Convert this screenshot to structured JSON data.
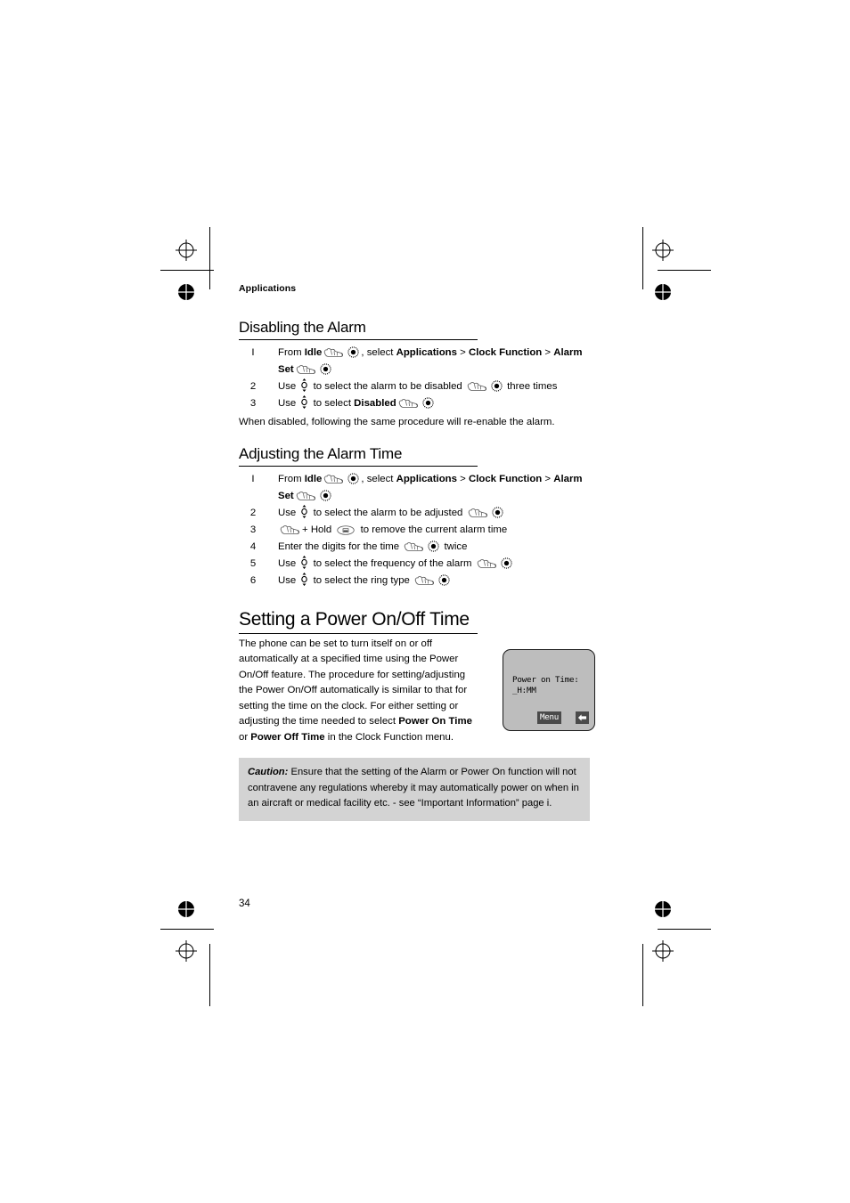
{
  "running_head": "Applications",
  "folio": "34",
  "colors": {
    "caution_bg": "#d3d3d3",
    "screen_bg": "#bdbdbd",
    "softkey_bg": "#4a4a4a",
    "ink": "#000000"
  },
  "sections": [
    {
      "heading": "Disabling the Alarm",
      "steps": [
        {
          "num": "I",
          "parts": [
            {
              "t": "text",
              "v": "From "
            },
            {
              "t": "bold",
              "v": "Idle"
            },
            {
              "t": "icon",
              "v": "hand-keypress-icon"
            },
            {
              "t": "icon",
              "v": "select-button-icon"
            },
            {
              "t": "text",
              "v": ", select "
            },
            {
              "t": "bold",
              "v": "Applications"
            },
            {
              "t": "text",
              "v": " > "
            },
            {
              "t": "bold",
              "v": "Clock Function"
            },
            {
              "t": "text",
              "v": " > "
            },
            {
              "t": "bold",
              "v": "Alarm Set"
            },
            {
              "t": "icon",
              "v": "hand-keypress-icon"
            },
            {
              "t": "icon",
              "v": "select-button-icon"
            }
          ]
        },
        {
          "num": "2",
          "parts": [
            {
              "t": "text",
              "v": "Use "
            },
            {
              "t": "icon",
              "v": "up-down-navigation-key-icon"
            },
            {
              "t": "text",
              "v": " to select the alarm to be disabled "
            },
            {
              "t": "icon",
              "v": "hand-keypress-icon"
            },
            {
              "t": "icon",
              "v": "select-button-icon"
            },
            {
              "t": "text",
              "v": " three times"
            }
          ]
        },
        {
          "num": "3",
          "parts": [
            {
              "t": "text",
              "v": "Use "
            },
            {
              "t": "icon",
              "v": "up-down-navigation-key-icon"
            },
            {
              "t": "text",
              "v": " to select "
            },
            {
              "t": "bold",
              "v": "Disabled"
            },
            {
              "t": "icon",
              "v": "hand-keypress-icon"
            },
            {
              "t": "icon",
              "v": "select-button-icon"
            }
          ]
        }
      ],
      "trailing_text": "When disabled, following the same procedure will re-enable the alarm."
    },
    {
      "heading": "Adjusting the Alarm Time",
      "steps": [
        {
          "num": "I",
          "parts": [
            {
              "t": "text",
              "v": "From "
            },
            {
              "t": "bold",
              "v": "Idle"
            },
            {
              "t": "icon",
              "v": "hand-keypress-icon"
            },
            {
              "t": "icon",
              "v": "select-button-icon"
            },
            {
              "t": "text",
              "v": ", select "
            },
            {
              "t": "bold",
              "v": "Applications"
            },
            {
              "t": "text",
              "v": " > "
            },
            {
              "t": "bold",
              "v": "Clock Function"
            },
            {
              "t": "text",
              "v": " > "
            },
            {
              "t": "bold",
              "v": "Alarm Set"
            },
            {
              "t": "icon",
              "v": "hand-keypress-icon"
            },
            {
              "t": "icon",
              "v": "select-button-icon"
            }
          ]
        },
        {
          "num": "2",
          "parts": [
            {
              "t": "text",
              "v": "Use "
            },
            {
              "t": "icon",
              "v": "up-down-navigation-key-icon"
            },
            {
              "t": "text",
              "v": " to select the alarm to be adjusted "
            },
            {
              "t": "icon",
              "v": "hand-keypress-icon"
            },
            {
              "t": "icon",
              "v": "select-button-icon"
            }
          ]
        },
        {
          "num": "3",
          "parts": [
            {
              "t": "icon",
              "v": "hand-keypress-icon"
            },
            {
              "t": "text",
              "v": "+ Hold "
            },
            {
              "t": "icon",
              "v": "clear-key-icon"
            },
            {
              "t": "text",
              "v": " to remove the current alarm time"
            }
          ]
        },
        {
          "num": "4",
          "parts": [
            {
              "t": "text",
              "v": "Enter the digits for the time "
            },
            {
              "t": "icon",
              "v": "hand-keypress-icon"
            },
            {
              "t": "icon",
              "v": "select-button-icon"
            },
            {
              "t": "text",
              "v": " twice"
            }
          ]
        },
        {
          "num": "5",
          "parts": [
            {
              "t": "text",
              "v": "Use "
            },
            {
              "t": "icon",
              "v": "up-down-navigation-key-icon"
            },
            {
              "t": "text",
              "v": " to select the frequency of the alarm "
            },
            {
              "t": "icon",
              "v": "hand-keypress-icon"
            },
            {
              "t": "icon",
              "v": "select-button-icon"
            }
          ]
        },
        {
          "num": "6",
          "parts": [
            {
              "t": "text",
              "v": "Use "
            },
            {
              "t": "icon",
              "v": "up-down-navigation-key-icon"
            },
            {
              "t": "text",
              "v": " to select the ring type "
            },
            {
              "t": "icon",
              "v": "hand-keypress-icon"
            },
            {
              "t": "icon",
              "v": "select-button-icon"
            }
          ]
        }
      ],
      "trailing_text": ""
    }
  ],
  "chapter": {
    "title": "Setting a Power On/Off Time",
    "body_parts": [
      {
        "t": "text",
        "v": "The phone can be set to turn itself on or off automatically at a specified time using the Power On/Off feature. The procedure for setting/adjusting the Power On/Off automatically is similar to that for setting the time on the clock. For either setting or adjusting the time  needed to select "
      },
      {
        "t": "bold",
        "v": "Power On Time"
      },
      {
        "t": "text",
        "v": " or "
      },
      {
        "t": "bold",
        "v": "Power Off Time"
      },
      {
        "t": "text",
        "v": " in the Clock Function menu."
      }
    ]
  },
  "phone_screen": {
    "line1": "Power on Time:",
    "line2": "_H:MM",
    "softkey_label": "Menu",
    "back_icon": "left-arrow-icon"
  },
  "caution": {
    "label": "Caution:",
    "text": " Ensure that the setting of the Alarm or Power On function will not contravene any regulations whereby it may automatically power on when in an aircraft or medical facility etc. - see “Important Information” page i."
  }
}
